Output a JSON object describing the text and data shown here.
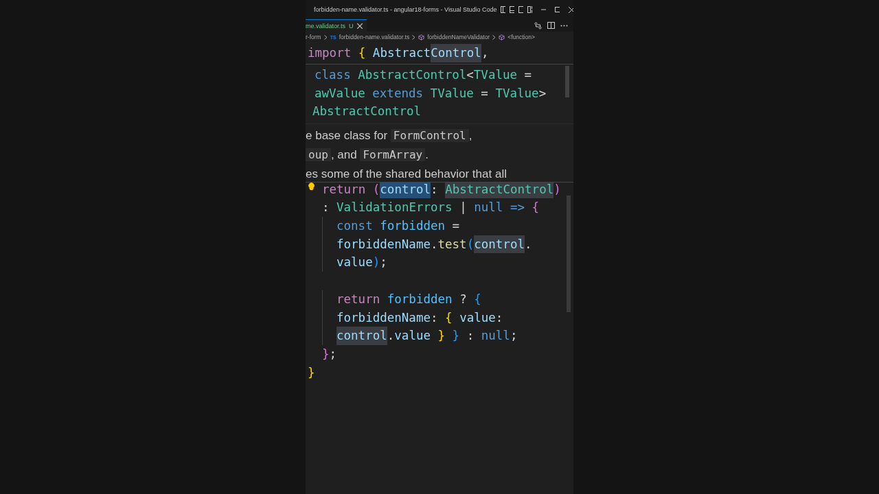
{
  "window": {
    "title": "forbidden-name.validator.ts - angular18-forms - Visual Studio Code"
  },
  "tabs": [
    {
      "label": "me.validator.ts",
      "badge": "U",
      "selected": true
    }
  ],
  "breadcrumb": [
    {
      "kind": "folder",
      "label": "r-form"
    },
    {
      "kind": "file",
      "icon": "TS",
      "label": "forbidden-name.validator.ts"
    },
    {
      "kind": "symbol",
      "label": "forbiddenNameValidator"
    },
    {
      "kind": "symbol",
      "label": "<function>"
    }
  ],
  "code_top": [
    {
      "tokens": [
        {
          "text": "import ",
          "kind": "keyword"
        },
        {
          "text": "{ ",
          "kind": "bracket1"
        },
        {
          "text": "Abstract",
          "kind": "variable"
        },
        {
          "text": "Control",
          "kind": "variable",
          "highlighted": true
        },
        {
          "text": ",",
          "kind": "punct"
        }
      ]
    }
  ],
  "hover": {
    "signature": [
      [
        {
          "text": "class ",
          "kind": "storage"
        },
        {
          "text": "AbstractControl",
          "kind": "type"
        },
        {
          "text": "<",
          "kind": "punct"
        },
        {
          "text": "TValue",
          "kind": "type"
        },
        {
          "text": " =",
          "kind": "punct"
        }
      ],
      [
        {
          "text": "awValue ",
          "kind": "type"
        },
        {
          "text": "extends ",
          "kind": "storage"
        },
        {
          "text": "TValue",
          "kind": "type"
        },
        {
          "text": " = ",
          "kind": "punct"
        },
        {
          "text": "TValue",
          "kind": "type"
        },
        {
          "text": ">",
          "kind": "punct"
        }
      ],
      [
        {
          "text": "AbstractControl",
          "kind": "type"
        }
      ]
    ],
    "doc": [
      [
        {
          "text": "e base class for ",
          "kind": "text"
        },
        {
          "text": "FormControl",
          "kind": "code"
        },
        {
          "text": ",",
          "kind": "text"
        }
      ],
      [
        {
          "text": "oup",
          "kind": "code"
        },
        {
          "text": ", and ",
          "kind": "text"
        },
        {
          "text": "FormArray",
          "kind": "code"
        },
        {
          "text": ".",
          "kind": "text"
        }
      ],
      [
        {
          "text": "es some of the shared behavior that all",
          "kind": "text"
        }
      ]
    ]
  },
  "code": [
    {
      "children": [
        {
          "lightbulb": true,
          "tokens": [
            {
              "text": "return ",
              "kind": "keyword"
            },
            {
              "text": "(",
              "kind": "bracket2"
            },
            {
              "text": "control",
              "kind": "variable",
              "selected": true
            },
            {
              "text": ": ",
              "kind": "punct"
            },
            {
              "text": "Abstract",
              "kind": "type",
              "highlighted": true
            },
            {
              "text": "Control",
              "kind": "type",
              "highlighted": true
            },
            {
              "text": ")",
              "kind": "bracket2"
            }
          ]
        },
        {
          "tokens": [
            {
              "text": ": ",
              "kind": "punct"
            },
            {
              "text": "ValidationErrors",
              "kind": "type"
            },
            {
              "text": " | ",
              "kind": "punct"
            },
            {
              "text": "null",
              "kind": "storage"
            },
            {
              "text": " => ",
              "kind": "storage"
            },
            {
              "text": "{",
              "kind": "bracket2"
            }
          ],
          "children": [
            {
              "tokens": [
                {
                  "text": "const ",
                  "kind": "storage"
                },
                {
                  "text": "forbidden",
                  "kind": "const"
                },
                {
                  "text": " =",
                  "kind": "punct"
                }
              ]
            },
            {
              "tokens": [
                {
                  "text": "forbiddenName",
                  "kind": "variable"
                },
                {
                  "text": ".",
                  "kind": "punct"
                },
                {
                  "text": "test",
                  "kind": "func"
                },
                {
                  "text": "(",
                  "kind": "bracket3"
                },
                {
                  "text": "control",
                  "kind": "variable",
                  "highlighted": true
                },
                {
                  "text": ".",
                  "kind": "punct"
                }
              ]
            },
            {
              "tokens": [
                {
                  "text": "value",
                  "kind": "variable"
                },
                {
                  "text": ")",
                  "kind": "bracket3"
                },
                {
                  "text": ";",
                  "kind": "punct"
                }
              ]
            },
            {
              "kind": "blank"
            },
            {
              "tokens": [
                {
                  "text": "return ",
                  "kind": "keyword"
                },
                {
                  "text": "forbidden",
                  "kind": "const"
                },
                {
                  "text": " ? ",
                  "kind": "punct"
                },
                {
                  "text": "{",
                  "kind": "bracket3"
                }
              ]
            },
            {
              "tokens": [
                {
                  "text": "forbiddenName",
                  "kind": "variable"
                },
                {
                  "text": ": ",
                  "kind": "punct"
                },
                {
                  "text": "{",
                  "kind": "bracket1"
                },
                {
                  "text": " value",
                  "kind": "variable"
                },
                {
                  "text": ":",
                  "kind": "punct"
                }
              ]
            },
            {
              "tokens": [
                {
                  "text": "control",
                  "kind": "variable",
                  "highlighted": true
                },
                {
                  "text": ".",
                  "kind": "punct"
                },
                {
                  "text": "value",
                  "kind": "variable"
                },
                {
                  "text": " } ",
                  "kind": "bracket1"
                },
                {
                  "text": "}",
                  "kind": "bracket3"
                },
                {
                  "text": " : ",
                  "kind": "punct"
                },
                {
                  "text": "null",
                  "kind": "storage"
                },
                {
                  "text": ";",
                  "kind": "punct"
                }
              ]
            }
          ]
        },
        {
          "tokens": [
            {
              "text": "}",
              "kind": "bracket2"
            },
            {
              "text": ";",
              "kind": "punct"
            }
          ]
        }
      ]
    },
    {
      "tokens": [
        {
          "text": "}",
          "kind": "bracket1"
        }
      ]
    }
  ]
}
